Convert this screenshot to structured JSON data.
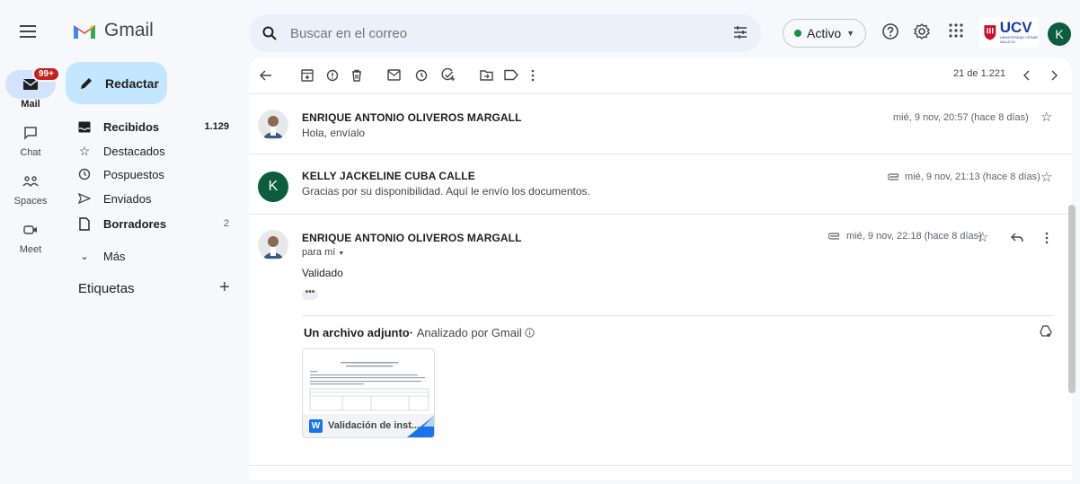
{
  "app": {
    "name": "Gmail"
  },
  "rail": {
    "items": [
      {
        "label": "Mail",
        "badge": "99+"
      },
      {
        "label": "Chat"
      },
      {
        "label": "Spaces"
      },
      {
        "label": "Meet"
      }
    ]
  },
  "search": {
    "placeholder": "Buscar en el correo"
  },
  "status": {
    "label": "Activo"
  },
  "org": {
    "logo_text": "UCV",
    "logo_sub": "UNIVERSIDAD CÉSAR VALLEJO"
  },
  "user": {
    "initial": "K"
  },
  "compose": {
    "label": "Redactar"
  },
  "nav": [
    {
      "label": "Recibidos",
      "count": "1.129"
    },
    {
      "label": "Destacados",
      "count": ""
    },
    {
      "label": "Pospuestos",
      "count": ""
    },
    {
      "label": "Enviados",
      "count": ""
    },
    {
      "label": "Borradores",
      "count": "2"
    },
    {
      "label": "Más",
      "count": ""
    }
  ],
  "labels": {
    "title": "Etiquetas"
  },
  "pager": {
    "text": "21 de 1.221"
  },
  "messages": [
    {
      "sender": "ENRIQUE ANTONIO OLIVEROS MARGALL",
      "snippet": "Hola, envíalo",
      "date": "mié, 9 nov, 20:57 (hace 8 días)"
    },
    {
      "sender": "KELLY JACKELINE CUBA CALLE",
      "initial": "K",
      "snippet": "Gracias por su disponibilidad. Aquí le envío los documentos.",
      "date": "mié, 9 nov, 21:13 (hace 8 días)"
    },
    {
      "sender": "ENRIQUE ANTONIO OLIVEROS MARGALL",
      "to": "para mí",
      "body": "Validado",
      "date": "mié, 9 nov, 22:18 (hace 8 días)"
    }
  ],
  "attachment": {
    "title": "Un archivo adjunto",
    "scan": "Analizado por Gmail",
    "filename": "Validación de inst..."
  },
  "colors": {
    "accent": "#c2e7ff",
    "active_nav": "#d3e3fd",
    "avatar": "#0b5d3e",
    "status_green": "#1e8e3e"
  }
}
